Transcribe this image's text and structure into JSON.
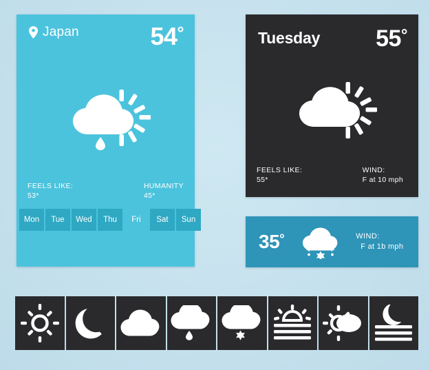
{
  "page": {
    "background_color": "#cbe5f0"
  },
  "main_card": {
    "background_color": "#4bc3dd",
    "location_icon": "location-pin-icon",
    "location": "Japan",
    "temperature": "54",
    "degree_symbol": "°",
    "weather_icon": "sun-behind-rain-cloud-icon",
    "feels_like_label": "FEELS LIKE:",
    "feels_like_value": "53*",
    "humidity_label": "HUMANITY",
    "humidity_value": "45*",
    "days": [
      {
        "label": "Mon",
        "active": false
      },
      {
        "label": "Tue",
        "active": false
      },
      {
        "label": "Wed",
        "active": false
      },
      {
        "label": "Thu",
        "active": false
      },
      {
        "label": "Fri",
        "active": true
      },
      {
        "label": "Sat",
        "active": false
      },
      {
        "label": "Sun",
        "active": false
      }
    ],
    "day_button_color": "#2ea8c3"
  },
  "dark_card": {
    "background_color": "#2a2a2c",
    "title": "Tuesday",
    "temperature": "55",
    "degree_symbol": "°",
    "weather_icon": "sun-behind-cloud-icon",
    "feels_like_label": "FEELS LIKE:",
    "feels_like_value": "55*",
    "wind_label": "WIND:",
    "wind_value": "F at 10 mph"
  },
  "small_card": {
    "background_color": "#2e94b8",
    "temperature": "35",
    "degree_symbol": "°",
    "weather_icon": "snow-cloud-icon",
    "wind_label": "WIND:",
    "wind_value": "F at 1b mph"
  },
  "icon_strip": {
    "tile_color": "#2a2a2c",
    "icons": [
      {
        "name": "sun-icon",
        "title": "Sun"
      },
      {
        "name": "moon-icon",
        "title": "Moon"
      },
      {
        "name": "cloud-icon",
        "title": "Cloud"
      },
      {
        "name": "rain-cloud-icon",
        "title": "Rain"
      },
      {
        "name": "snow-cloud-icon",
        "title": "Snow"
      },
      {
        "name": "sunrise-icon",
        "title": "Sunrise"
      },
      {
        "name": "partly-cloudy-sun-icon",
        "title": "Partly cloudy"
      },
      {
        "name": "moonset-icon",
        "title": "Moonset"
      }
    ]
  }
}
